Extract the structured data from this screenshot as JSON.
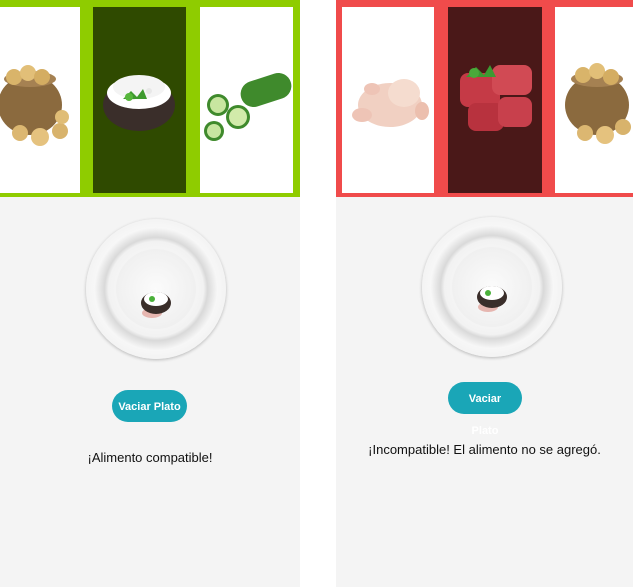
{
  "screens": [
    {
      "accent_color": "#8fcc00",
      "selected_card_color": "#2f4a00",
      "foods": [
        {
          "name": "potatoes-sack-icon"
        },
        {
          "name": "rice-bowl-icon"
        },
        {
          "name": "cucumber-icon"
        }
      ],
      "button_label": "Vaciar Plato",
      "message": "¡Alimento compatible!"
    },
    {
      "accent_color": "#f04b4b",
      "selected_card_color": "#4a1818",
      "foods": [
        {
          "name": "raw-chicken-icon"
        },
        {
          "name": "raw-meat-icon"
        },
        {
          "name": "potatoes-sack-icon"
        }
      ],
      "button_label": "Vaciar Plato",
      "message": "¡Incompatible! El alimento no se agregó."
    }
  ]
}
